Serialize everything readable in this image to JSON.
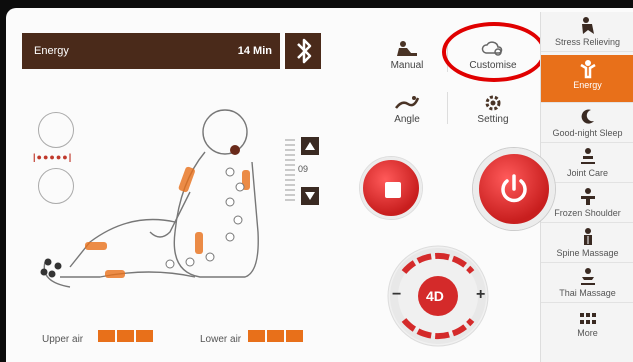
{
  "program": {
    "name": "Energy",
    "time": "14 Min"
  },
  "bluetooth_icon": "bluetooth-icon",
  "modes": [
    {
      "label": "Manual",
      "icon": "manual-icon"
    },
    {
      "label": "Customise",
      "icon": "customise-icon"
    },
    {
      "label": "Angle",
      "icon": "angle-icon"
    },
    {
      "label": "Setting",
      "icon": "setting-icon"
    }
  ],
  "sidebar": {
    "items": [
      {
        "label": "Stress Relieving",
        "active": false
      },
      {
        "label": "Energy",
        "active": true
      },
      {
        "label": "Good-night Sleep",
        "active": false
      },
      {
        "label": "Joint Care",
        "active": false
      },
      {
        "label": "Frozen Shoulder",
        "active": false
      },
      {
        "label": "Spine Massage",
        "active": false
      },
      {
        "label": "Thai Massage",
        "active": false
      },
      {
        "label": "More",
        "active": false
      }
    ]
  },
  "level": {
    "value": "09"
  },
  "intensity_dots": "|●●●●●|",
  "fourd": {
    "label": "4D",
    "minus": "−",
    "plus": "+"
  },
  "air": {
    "upper_label": "Upper air",
    "lower_label": "Lower air",
    "upper_segments": 3,
    "lower_segments": 3
  },
  "colors": {
    "accent": "#e8701a",
    "header_bg": "#4a2a1a",
    "button_red": "#d42a2a",
    "highlight": "#e00000"
  }
}
